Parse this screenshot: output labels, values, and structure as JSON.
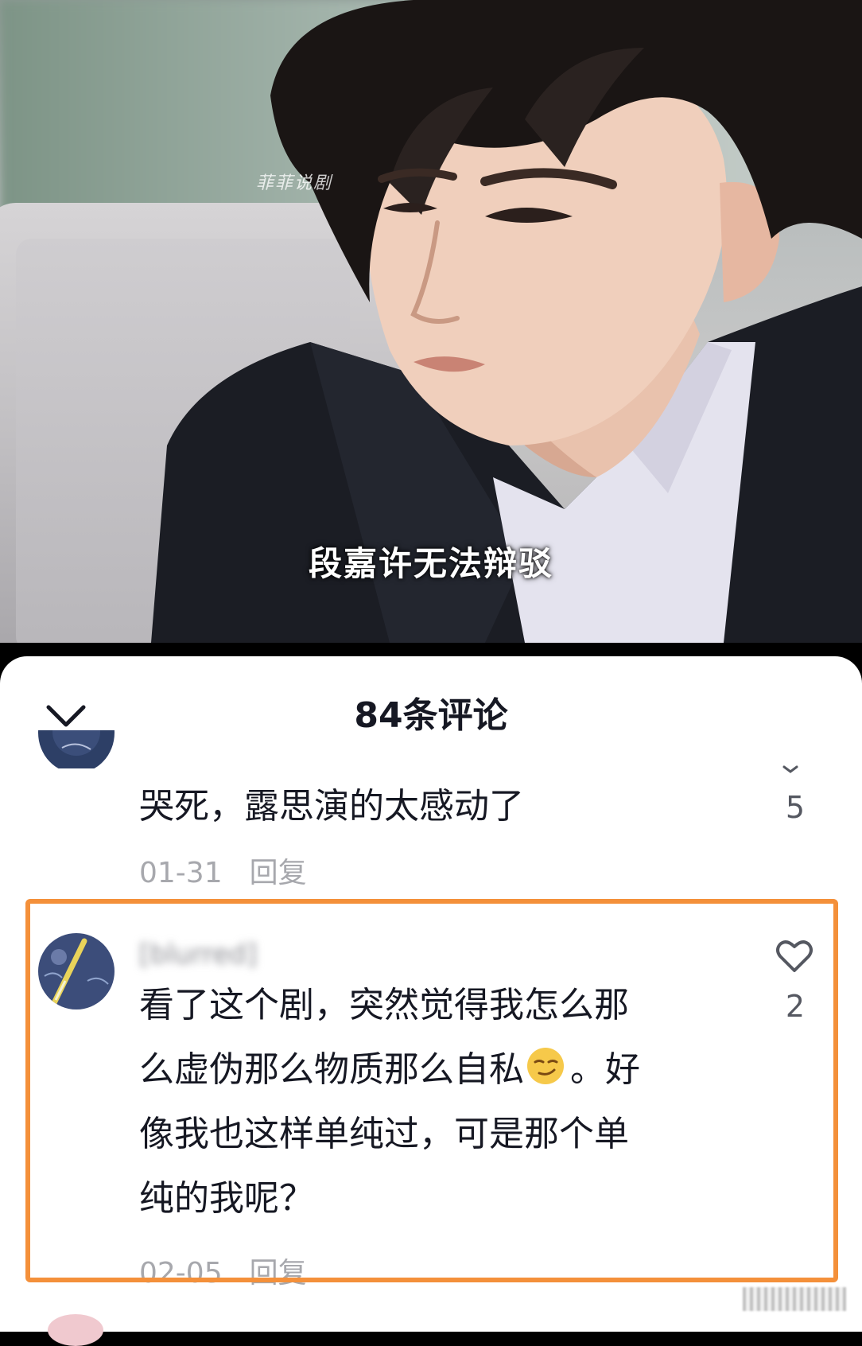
{
  "video": {
    "watermark": "菲菲说剧",
    "subtitle": "段嘉许无法辩驳"
  },
  "sheet": {
    "title": "84条评论"
  },
  "comments": [
    {
      "text": "哭死，露思演的太感动了",
      "date": "01-31",
      "reply_label": "回复",
      "likes": "5"
    },
    {
      "username": "[blurred]",
      "text_line1": "看了这个剧，突然觉得我怎么那",
      "text_line2a": "么虚伪那么物质那么自私",
      "text_line2b": "。好",
      "text_line3": "像我也这样单纯过，可是那个单",
      "text_line4": "纯的我呢？",
      "date": "02-05",
      "reply_label": "回复",
      "likes": "2"
    }
  ],
  "colors": {
    "highlight": "#f4903a",
    "text": "#161823",
    "meta": "#a7a8ad"
  }
}
